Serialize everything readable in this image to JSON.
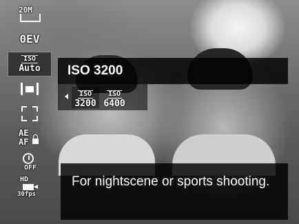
{
  "sidebar": {
    "items": [
      {
        "id": "resolution",
        "icon": "image-size-icon",
        "text": "20M"
      },
      {
        "id": "ev",
        "icon": "exposure-compensation-icon",
        "text": "0EV"
      },
      {
        "id": "iso",
        "icon": "iso-icon",
        "tag": "ISO",
        "text": "Auto",
        "selected": true
      },
      {
        "id": "metering",
        "icon": "spot-metering-icon"
      },
      {
        "id": "af-area",
        "icon": "af-area-icon"
      },
      {
        "id": "ae-af-lock",
        "icon": "ae-af-lock-icon",
        "text_top": "AE",
        "text_bottom": "AF"
      },
      {
        "id": "self-timer",
        "icon": "self-timer-icon",
        "text": "OFF"
      },
      {
        "id": "video",
        "icon": "video-quality-icon",
        "text_top": "HD",
        "text_bottom": "30fps"
      }
    ]
  },
  "submenu": {
    "title": "ISO 3200",
    "options": [
      {
        "tag": "ISO",
        "value": "3200",
        "selected": true
      },
      {
        "tag": "ISO",
        "value": "6400",
        "selected": false
      }
    ]
  },
  "description": "For nightscene or sports shooting.",
  "colors": {
    "text": "#ffffff",
    "panel": "#000000"
  }
}
